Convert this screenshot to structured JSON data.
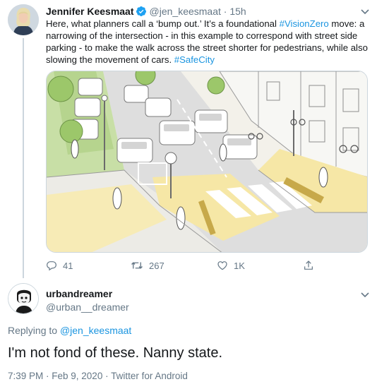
{
  "tweet": {
    "author_name": "Jennifer Keesmaat",
    "handle": "@jen_keesmaat",
    "separator": "·",
    "time": "15h",
    "text_parts": [
      "Here, what planners call a ‘bump out.’ It’s a foundational ",
      "#VisionZero",
      " move: a narrowing of the intersection - in this example to correspond with street side parking - to make the walk across the street shorter for pedestrians, while also slowing the movement of cars. ",
      "#SafeCity"
    ],
    "stats": {
      "replies": "41",
      "retweets": "267",
      "likes": "1K"
    },
    "icons": {
      "reply": "reply-icon",
      "retweet": "retweet-icon",
      "like": "heart-icon",
      "share": "share-icon",
      "more": "chevron-down-icon",
      "verified": "verified-badge-icon"
    }
  },
  "reply": {
    "author_name": "urbandreamer",
    "handle": "@urban__dreamer",
    "replying_prefix": "Replying to ",
    "replying_to": "@jen_keesmaat",
    "text": "I'm not fond of these. Nanny state.",
    "meta": "7:39 PM · Feb 9, 2020 · Twitter for Android"
  },
  "colors": {
    "link": "#1b95e0",
    "secondary_text": "#657786",
    "primary_text": "#14171a",
    "border": "#ccd6dd"
  }
}
